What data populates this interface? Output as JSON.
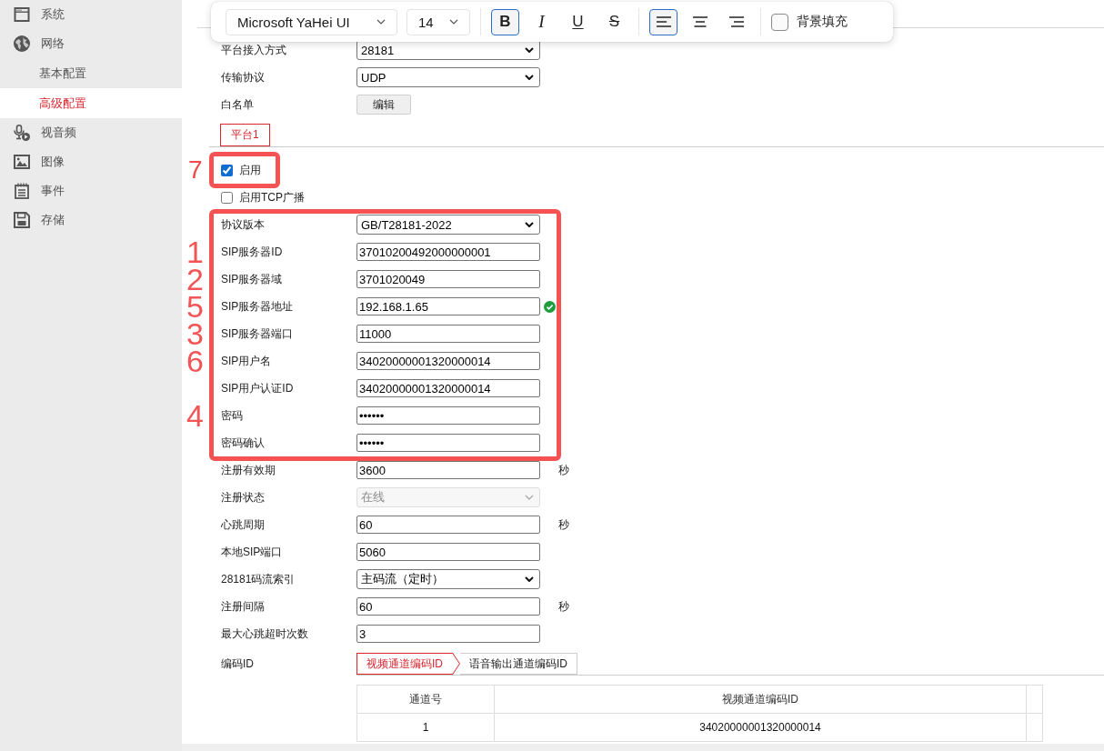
{
  "sidebar": {
    "items": [
      {
        "label": "系统",
        "selected": false
      },
      {
        "label": "网络",
        "selected": false,
        "children": [
          {
            "label": "基本配置",
            "selected": false
          },
          {
            "label": "高级配置",
            "selected": true
          }
        ]
      },
      {
        "label": "视音频",
        "selected": false
      },
      {
        "label": "图像",
        "selected": false
      },
      {
        "label": "事件",
        "selected": false
      },
      {
        "label": "存储",
        "selected": false
      }
    ]
  },
  "toolbar": {
    "dropdowns": [
      {
        "value": "Microsoft YaHei UI"
      },
      {
        "value": "14"
      }
    ],
    "format_buttons": [
      {
        "kind": "bold",
        "label": "B",
        "selected": true
      },
      {
        "kind": "italic",
        "label": "I",
        "selected": false
      },
      {
        "kind": "underline",
        "label": "U",
        "selected": false
      },
      {
        "kind": "strikethrough",
        "label": "S",
        "selected": false
      }
    ],
    "align_buttons": [
      {
        "kind": "left",
        "selected": true
      },
      {
        "kind": "center",
        "selected": false
      },
      {
        "kind": "right",
        "selected": false
      }
    ],
    "fill_checkbox": {
      "label": "背景填充",
      "checked": false
    }
  },
  "general_fields": [
    {
      "label": "平台接入方式",
      "kind": "select",
      "value": "28181",
      "disabled": false
    },
    {
      "label": "传输协议",
      "kind": "select",
      "value": "UDP",
      "disabled": false
    },
    {
      "label": "白名单",
      "kind": "button",
      "value": "编辑",
      "disabled": false
    }
  ],
  "platform_tabs": [
    {
      "label": "平台1",
      "selected": true
    }
  ],
  "checkboxes": [
    {
      "label": "启用",
      "checked": true,
      "highlighted": true,
      "marker": "7"
    },
    {
      "label": "启用TCP广播",
      "checked": false,
      "highlighted": false
    }
  ],
  "sip_fields": {
    "highlighted": true,
    "rows": [
      {
        "label": "协议版本",
        "kind": "select",
        "value": "GB/T28181-2022",
        "disabled": false,
        "valid": false
      },
      {
        "label": "SIP服务器ID",
        "kind": "text",
        "value": "37010200492000000001",
        "disabled": false,
        "valid": false,
        "marker": "1"
      },
      {
        "label": "SIP服务器域",
        "kind": "text",
        "value": "3701020049",
        "disabled": false,
        "valid": false,
        "marker": "2"
      },
      {
        "label": "SIP服务器地址",
        "kind": "text",
        "value": "192.168.1.65",
        "disabled": false,
        "valid": true,
        "marker": "5"
      },
      {
        "label": "SIP服务器端口",
        "kind": "text",
        "value": "11000",
        "disabled": false,
        "valid": false,
        "marker": "3"
      },
      {
        "label": "SIP用户名",
        "kind": "text",
        "value": "34020000001320000014",
        "disabled": false,
        "valid": false,
        "marker": "6"
      },
      {
        "label": "SIP用户认证ID",
        "kind": "text",
        "value": "34020000001320000014",
        "disabled": false,
        "valid": false
      },
      {
        "label": "密码",
        "kind": "password",
        "value": "••••••",
        "disabled": false,
        "valid": false,
        "marker": "4"
      },
      {
        "label": "密码确认",
        "kind": "password",
        "value": "••••••",
        "disabled": false,
        "valid": false
      }
    ]
  },
  "more_fields": [
    {
      "label": "注册有效期",
      "kind": "text",
      "value": "3600",
      "disabled": false,
      "unit": "秒"
    },
    {
      "label": "注册状态",
      "kind": "select",
      "value": "在线",
      "disabled": true
    },
    {
      "label": "心跳周期",
      "kind": "text",
      "value": "60",
      "disabled": false,
      "unit": "秒"
    },
    {
      "label": "本地SIP端口",
      "kind": "text",
      "value": "5060",
      "disabled": false
    },
    {
      "label": "28181码流索引",
      "kind": "select",
      "value": "主码流（定时）",
      "disabled": false
    },
    {
      "label": "注册间隔",
      "kind": "text",
      "value": "60",
      "disabled": false,
      "unit": "秒"
    },
    {
      "label": "最大心跳超时次数",
      "kind": "text",
      "value": "3",
      "disabled": false
    }
  ],
  "code_id": {
    "label": "编码ID",
    "tabs": [
      {
        "label": "视频通道编码ID",
        "selected": true
      },
      {
        "label": "语音输出通道编码ID",
        "selected": false
      }
    ],
    "table": {
      "columns": [
        "通道号",
        "视频通道编码ID"
      ],
      "rows": [
        [
          "1",
          "34020000001320000014"
        ]
      ]
    }
  }
}
